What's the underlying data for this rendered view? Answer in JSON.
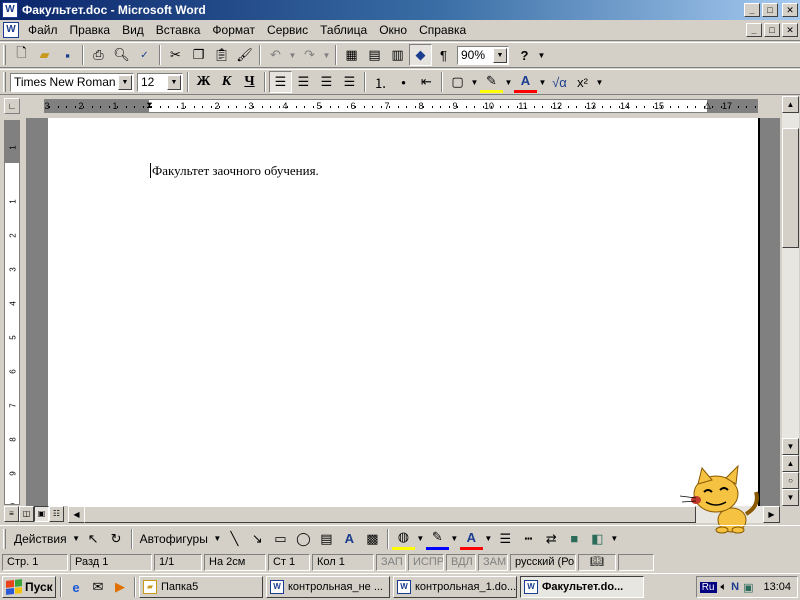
{
  "window": {
    "title": "Факультет.doc - Microsoft Word",
    "app_icon": "W",
    "buttons": {
      "minimize": "_",
      "maximize": "□",
      "close": "✕"
    }
  },
  "menu": {
    "items": [
      "Файл",
      "Правка",
      "Вид",
      "Вставка",
      "Формат",
      "Сервис",
      "Таблица",
      "Окно",
      "Справка"
    ]
  },
  "standard_toolbar": {
    "zoom": "90%"
  },
  "formatting_toolbar": {
    "font_name": "Times New Roman",
    "font_size": "12",
    "bold": "Ж",
    "italic": "К",
    "underline": "Ч"
  },
  "ruler": {
    "horizontal_labels": [
      "3",
      "2",
      "1",
      "1",
      "2",
      "3",
      "4",
      "5",
      "6",
      "7",
      "8",
      "9",
      "10",
      "11",
      "12",
      "13",
      "14",
      "15",
      "17"
    ],
    "vertical_labels": [
      "1",
      "1",
      "2",
      "3",
      "4",
      "5",
      "6",
      "7",
      "8",
      "9",
      "10"
    ]
  },
  "document": {
    "text": "Факультет заочного обучения."
  },
  "drawing_toolbar": {
    "actions": "Действия",
    "autoshapes": "Автофигуры"
  },
  "status": {
    "page": "Стр. 1",
    "section": "Разд 1",
    "pages": "1/1",
    "at": "На 2см",
    "line": "Ст 1",
    "col": "Кол 1",
    "rec": "ЗАП",
    "trk": "ИСПР",
    "ext": "ВДЛ",
    "ovr": "ЗАМ",
    "language": "русский (Ро"
  },
  "taskbar": {
    "start": "Пуск",
    "tasks": [
      {
        "label": "Папка5",
        "active": false
      },
      {
        "label": "контрольная_не ...",
        "active": false
      },
      {
        "label": "контрольная_1.do...",
        "active": false
      },
      {
        "label": "Факультет.do...",
        "active": true
      }
    ],
    "tray_lang": "Ru",
    "clock": "13:04"
  },
  "colors": {
    "title_active": "#0a246a",
    "face": "#d4d0c8",
    "workspace": "#808080"
  }
}
